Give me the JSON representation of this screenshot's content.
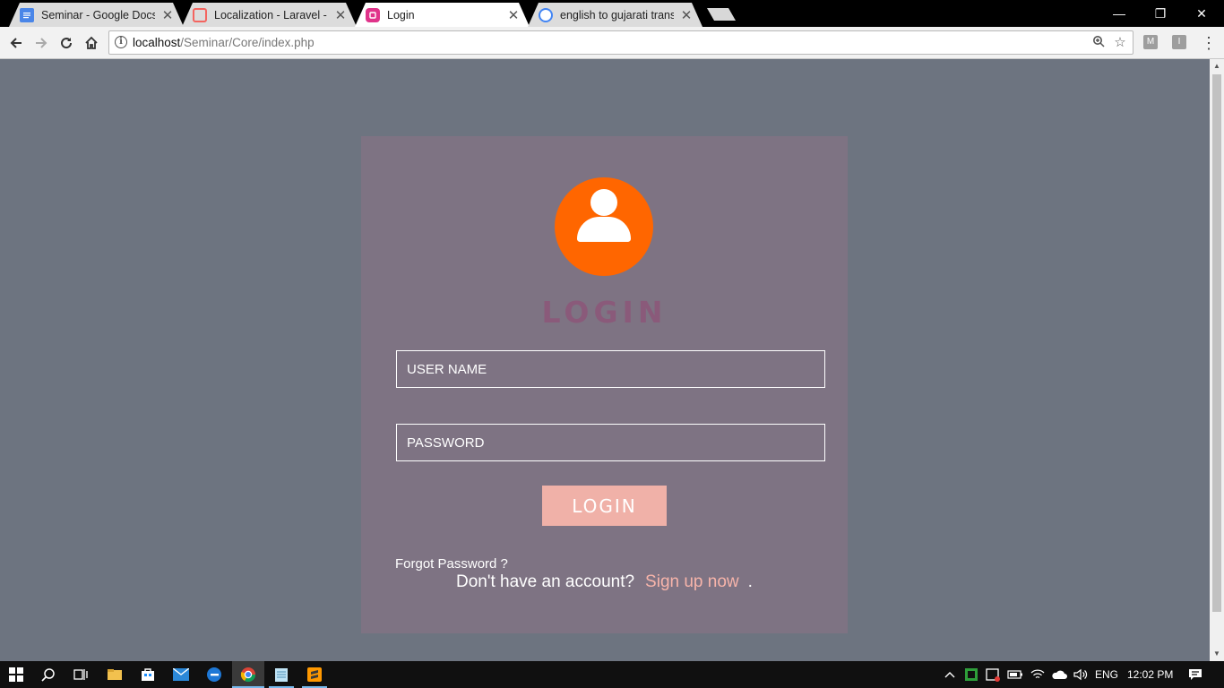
{
  "browser": {
    "tabs": [
      {
        "title": "Seminar - Google Docs",
        "icon": "google-docs-icon",
        "color": "#4a86e8",
        "active": false
      },
      {
        "title": "Localization - Laravel - Th",
        "icon": "laravel-icon",
        "color": "#f4645f",
        "active": false
      },
      {
        "title": "Login",
        "icon": "page-icon",
        "color": "#e0338a",
        "active": true
      },
      {
        "title": "english to gujarati transla",
        "icon": "google-icon",
        "color": "#4285f4",
        "active": false
      }
    ],
    "address": {
      "host": "localhost",
      "path": "/Seminar/Core/index.php"
    },
    "extensions": [
      "M",
      "I"
    ]
  },
  "login": {
    "title": "LOGIN",
    "username_placeholder": "USER NAME",
    "password_placeholder": "PASSWORD",
    "button_label": "LOGIN",
    "forgot": "Forgot Password ?",
    "signup_prompt": "Don't have an account?",
    "signup_link": "Sign up now",
    "signup_period": ".",
    "avatar_color": "#ff6600",
    "accent_color": "#f0b1a8"
  },
  "taskbar": {
    "language": "ENG",
    "time": "12:02 PM"
  }
}
